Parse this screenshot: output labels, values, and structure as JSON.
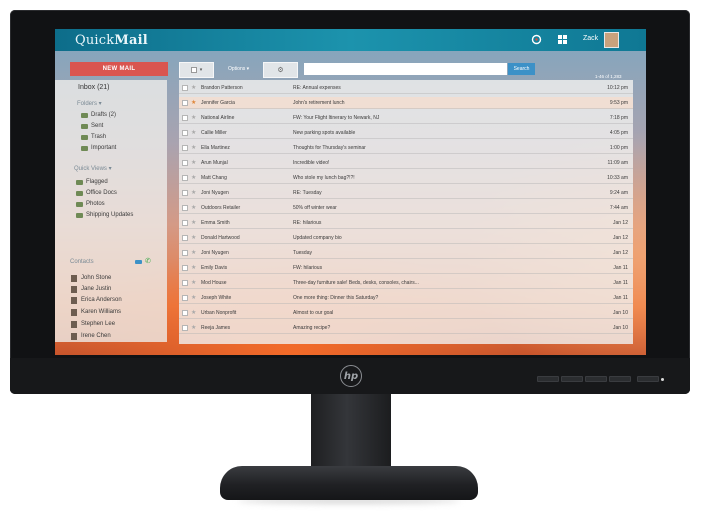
{
  "app": {
    "title_light": "Quick",
    "title_bold": "Mail",
    "user_name": "Zack"
  },
  "toolbar": {
    "new_mail": "NEW MAIL",
    "options": "Options ▾",
    "search_placeholder": "",
    "search_button": "Search",
    "count": "1-46 of 1,283"
  },
  "sidebar": {
    "inbox": "Inbox (21)",
    "folders_heading": "Folders ▾",
    "folders": [
      "Drafts (2)",
      "Sent",
      "Trash",
      "Important"
    ],
    "quick_views_heading": "Quick Views ▾",
    "quick_views": [
      "Flagged",
      "Office Docs",
      "Photos",
      "Shipping Updates"
    ],
    "contacts_heading": "Contacts",
    "contacts": [
      "John Stone",
      "Jane Justin",
      "Erica Anderson",
      "Karen Williams",
      "Stephen Lee",
      "Irene Chen"
    ]
  },
  "emails": [
    {
      "sender": "Brandon Patterson",
      "subject": "RE: Annual expenses",
      "time": "10:12 pm",
      "starred": false
    },
    {
      "sender": "Jennifer Garcia",
      "subject": "John's retirement lunch",
      "time": "9:53 pm",
      "starred": true
    },
    {
      "sender": "National Airline",
      "subject": "FW: Your Flight Itinerary to Newark, NJ",
      "time": "7:18 pm",
      "starred": false
    },
    {
      "sender": "Callie Miller",
      "subject": "New parking spots available",
      "time": "4:05 pm",
      "starred": false
    },
    {
      "sender": "Ella Martinez",
      "subject": "Thoughts for Thursday's seminar",
      "time": "1:00 pm",
      "starred": false
    },
    {
      "sender": "Arun Munjal",
      "subject": "Incredible video!",
      "time": "11:09 am",
      "starred": false
    },
    {
      "sender": "Matt Chang",
      "subject": "Who stole my lunch bag?!?!",
      "time": "10:33 am",
      "starred": false
    },
    {
      "sender": "Joni Nyugen",
      "subject": "RE: Tuesday",
      "time": "9:24 am",
      "starred": false
    },
    {
      "sender": "Outdoors Retailer",
      "subject": "50% off winter wear",
      "time": "7:44 am",
      "starred": false
    },
    {
      "sender": "Emma Smith",
      "subject": "RE: hilarious",
      "time": "Jan 12",
      "starred": false
    },
    {
      "sender": "Donald Hartwood",
      "subject": "Updated company bio",
      "time": "Jan 12",
      "starred": false
    },
    {
      "sender": "Joni Nyugen",
      "subject": "Tuesday",
      "time": "Jan 12",
      "starred": false
    },
    {
      "sender": "Emily Davis",
      "subject": "FW: hilarious",
      "time": "Jan 11",
      "starred": false
    },
    {
      "sender": "Mod House",
      "subject": "Three-day furniture sale! Beds, desks, consoles, chairs...",
      "time": "Jan 11",
      "starred": false
    },
    {
      "sender": "Joseph White",
      "subject": "One more thing: Dinner this Saturday?",
      "time": "Jan 11",
      "starred": false
    },
    {
      "sender": "Urban Nonprofit",
      "subject": "Almost to our goal",
      "time": "Jan 10",
      "starred": false
    },
    {
      "sender": "Reeja James",
      "subject": "Amazing recipe?",
      "time": "Jan 10",
      "starred": false
    }
  ],
  "colors": {
    "topbar": "#1c93ad",
    "new_mail_button": "#d95550",
    "search_button": "#3c91c7",
    "selected_row": "#fadcc8",
    "star_active": "#e0873a"
  },
  "icons": {
    "monitor_logo": "hp-logo",
    "topbar": [
      "refresh-icon",
      "apps-icon",
      "avatar"
    ],
    "contact_actions": [
      "video-icon",
      "phone-icon"
    ]
  }
}
